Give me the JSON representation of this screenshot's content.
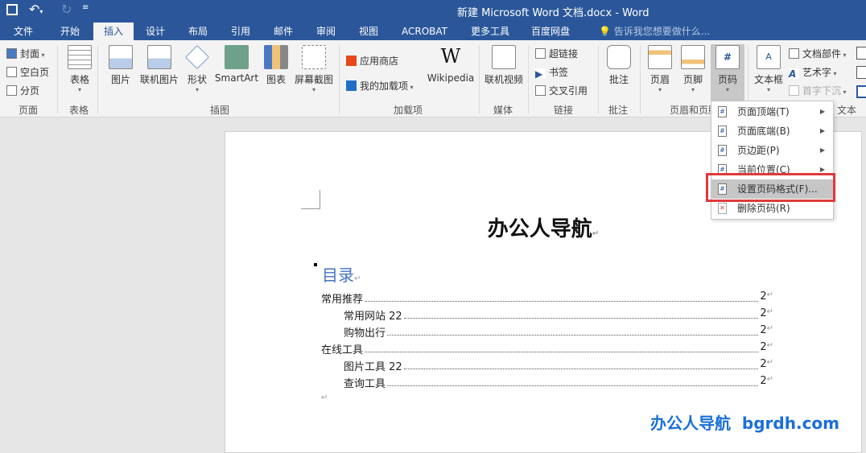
{
  "window": {
    "title": "新建 Microsoft Word 文档.docx - Word"
  },
  "qat": {
    "save": "save-icon",
    "undo": "undo-icon",
    "redo": "redo-icon",
    "customize": "customize-icon"
  },
  "tabs": [
    "文件",
    "开始",
    "插入",
    "设计",
    "布局",
    "引用",
    "邮件",
    "审阅",
    "视图",
    "ACROBAT",
    "更多工具",
    "百度网盘"
  ],
  "tell_me": "告诉我您想要做什么...",
  "ribbon": {
    "pages": {
      "items": [
        "封面",
        "空白页",
        "分页"
      ],
      "label": "页面"
    },
    "tables": {
      "item": "表格",
      "label": "表格"
    },
    "illustrations": {
      "items": [
        "图片",
        "联机图片",
        "形状",
        "SmartArt",
        "图表",
        "屏幕截图"
      ],
      "label": "插图"
    },
    "addins": {
      "items": [
        "应用商店",
        "我的加载项",
        "Wikipedia"
      ],
      "label": "加载项"
    },
    "media": {
      "item": "联机视频",
      "label": "媒体"
    },
    "links": {
      "items": [
        "超链接",
        "书签",
        "交叉引用"
      ],
      "label": "链接"
    },
    "comments": {
      "item": "批注",
      "label": "批注"
    },
    "header_footer": {
      "items": [
        "页眉",
        "页脚",
        "页码"
      ],
      "label": "页眉和页脚"
    },
    "text": {
      "items": [
        "文本框",
        "文档部件",
        "艺术字",
        "首字下沉"
      ],
      "label": "文本"
    }
  },
  "menu": {
    "items": [
      "页面顶端(T)",
      "页面底端(B)",
      "页边距(P)",
      "当前位置(C)",
      "设置页码格式(F)...",
      "删除页码(R)"
    ]
  },
  "document": {
    "title": "办公人导航",
    "toc_heading": "目录",
    "toc": [
      {
        "text": "常用推荐",
        "page": "2",
        "level": 1
      },
      {
        "text": "常用网站 22",
        "page": "2",
        "level": 2
      },
      {
        "text": "购物出行",
        "page": "2",
        "level": 2
      },
      {
        "text": "在线工具",
        "page": "2",
        "level": 1
      },
      {
        "text": "图片工具 22",
        "page": "2",
        "level": 2
      },
      {
        "text": "查询工具",
        "page": "2",
        "level": 2
      }
    ]
  },
  "watermark": "办公人导航  bgrdh.com",
  "colors": {
    "brand": "#2b579a",
    "highlight": "#e03a3a",
    "heading": "#4472c4"
  }
}
